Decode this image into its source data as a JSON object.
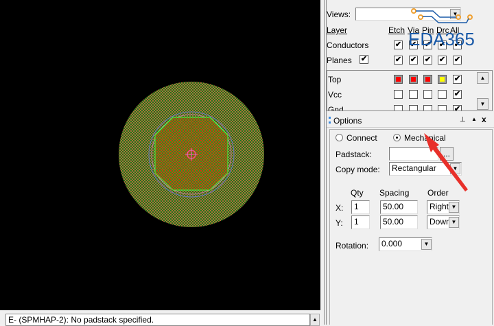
{
  "layers_panel": {
    "views_label": "Views:",
    "views_value": "",
    "headers": {
      "layer": "Layer",
      "etch": "Etch",
      "via": "Via",
      "pin": "Pin",
      "drc": "Drc",
      "all": "All"
    },
    "rows": [
      {
        "label": "Conductors",
        "subclass": null,
        "etch": true,
        "via": true,
        "pin": true,
        "drc": true,
        "all": true
      },
      {
        "label": "Planes",
        "subclass": true,
        "etch": true,
        "via": true,
        "pin": true,
        "drc": true,
        "all": true
      }
    ],
    "layers": [
      {
        "label": "Top",
        "colors": [
          "#ff0000",
          "#ff0000",
          "#ff0000",
          "#ffff00"
        ],
        "all": true
      },
      {
        "label": "Vcc",
        "colors": [
          null,
          null,
          null,
          null
        ],
        "all": true
      },
      {
        "label": "Gnd",
        "colors": [
          null,
          null,
          null,
          null
        ],
        "all": true
      }
    ]
  },
  "watermark": "EDA365",
  "options": {
    "title": "Options",
    "pin_icon": "pin-icon",
    "close_label": "x",
    "radio_connect": "Connect",
    "radio_mechanical": "Mechanical",
    "selected": "Mechanical",
    "padstack_label": "Padstack:",
    "padstack_value": "",
    "browse_label": "...",
    "copy_mode_label": "Copy mode:",
    "copy_mode_value": "Rectangular",
    "qty_label": "Qty",
    "spacing_label": "Spacing",
    "order_label": "Order",
    "x_label": "X:",
    "y_label": "Y:",
    "x_qty": "1",
    "x_spacing": "50.00",
    "x_order": "Right",
    "y_qty": "1",
    "y_spacing": "50.00",
    "y_order": "Down",
    "rotation_label": "Rotation:",
    "rotation_value": "0.000"
  },
  "status": {
    "message": "E- (SPMHAP-2): No padstack specified."
  },
  "colors": {
    "canvas": "#000000",
    "pad_outer": "#6a8a3a",
    "pad_inner": "#c04010",
    "arrow": "#e8302a",
    "brand": "#1a5aa8"
  }
}
